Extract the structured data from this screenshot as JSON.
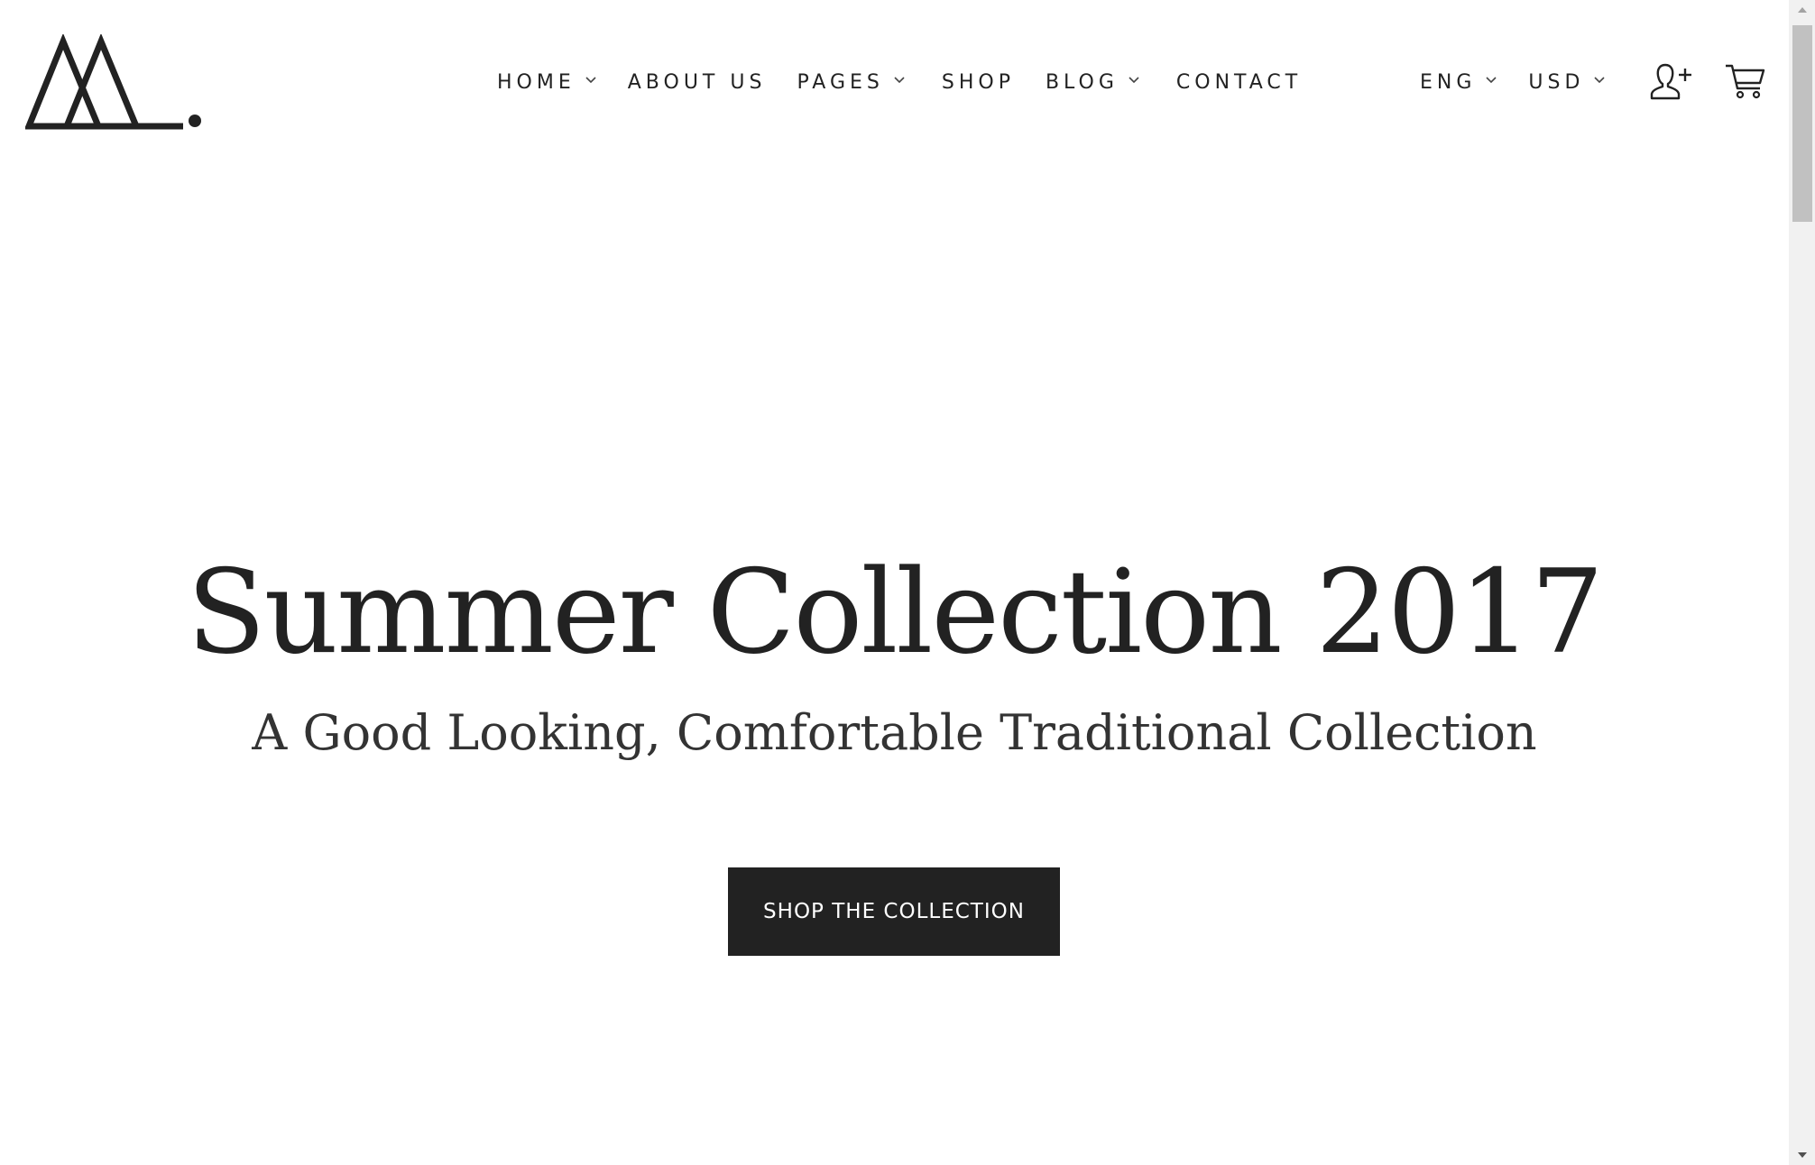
{
  "header": {
    "logo_icon": "mountain-logo-icon",
    "nav": [
      {
        "label": "HOME",
        "has_dropdown": true
      },
      {
        "label": "ABOUT US",
        "has_dropdown": false
      },
      {
        "label": "PAGES",
        "has_dropdown": true
      },
      {
        "label": "SHOP",
        "has_dropdown": false
      },
      {
        "label": "BLOG",
        "has_dropdown": true
      },
      {
        "label": "CONTACT",
        "has_dropdown": false
      }
    ],
    "language": {
      "value": "ENG",
      "icon": "chevron-down-icon"
    },
    "currency": {
      "value": "USD",
      "icon": "chevron-down-icon"
    },
    "account_icon": "add-user-icon",
    "cart_icon": "cart-icon"
  },
  "hero": {
    "title": "Summer Collection 2017",
    "subtitle": "A Good Looking, Comfortable Traditional Collection",
    "cta_label": "SHOP THE COLLECTION"
  },
  "colors": {
    "text": "#222222",
    "background": "#ffffff",
    "button_bg": "#222222",
    "button_text": "#ffffff",
    "scrollbar_track": "#f1f1f1",
    "scrollbar_thumb": "#c1c1c1"
  }
}
